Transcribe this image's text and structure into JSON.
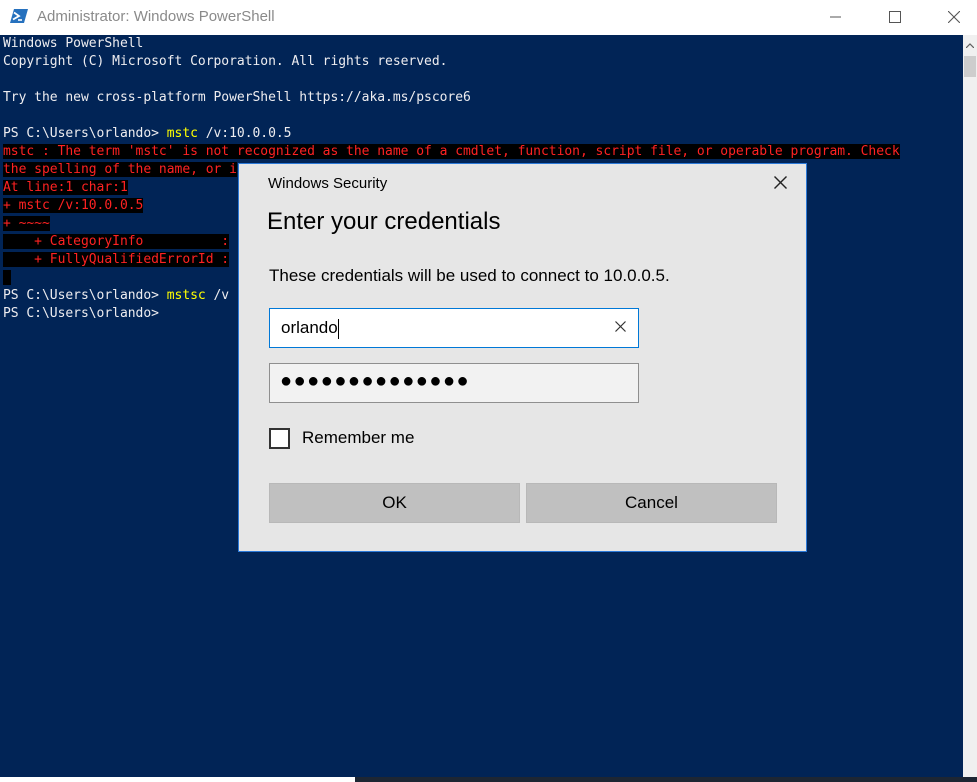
{
  "window": {
    "title": "Administrator: Windows PowerShell",
    "icon": "powershell-icon",
    "controls": [
      "minimize-icon",
      "maximize-icon",
      "close-icon"
    ]
  },
  "console": {
    "banner1": "Windows PowerShell",
    "banner2": "Copyright (C) Microsoft Corporation. All rights reserved.",
    "banner3": "Try the new cross-platform PowerShell https://aka.ms/pscore6",
    "prompt1": "PS C:\\Users\\orlando> ",
    "command1": "mstc",
    "command1_args": " /v:10.0.0.5",
    "error_line1": "mstc : The term 'mstc' is not recognized as the name of a cmdlet, function, script file, or operable program. Check",
    "error_line2": "the spelling of the name, or i",
    "error_line3": "At line:1 char:1",
    "error_line4": "+ mstc /v:10.0.0.5",
    "error_line5": "+ ~~~~",
    "error_line6": "    + CategoryInfo          :",
    "error_line7": "    + FullyQualifiedErrorId :",
    "prompt2": "PS C:\\Users\\orlando> ",
    "command2": "mstsc",
    "command2_args": " /v",
    "prompt3": "PS C:\\Users\\orlando>"
  },
  "dialog": {
    "caption": "Windows Security",
    "heading": "Enter your credentials",
    "message": "These credentials will be used to connect to 10.0.0.5.",
    "username_value": "orlando",
    "password_dots": "●●●●●●●●●●●●●●",
    "remember_label": "Remember me",
    "remember_checked": false,
    "ok_label": "OK",
    "cancel_label": "Cancel"
  },
  "colors": {
    "console_bg": "#012456",
    "command_text": "#ffff00",
    "error_text": "#ff2222",
    "dialog_border": "#2b79d8"
  }
}
